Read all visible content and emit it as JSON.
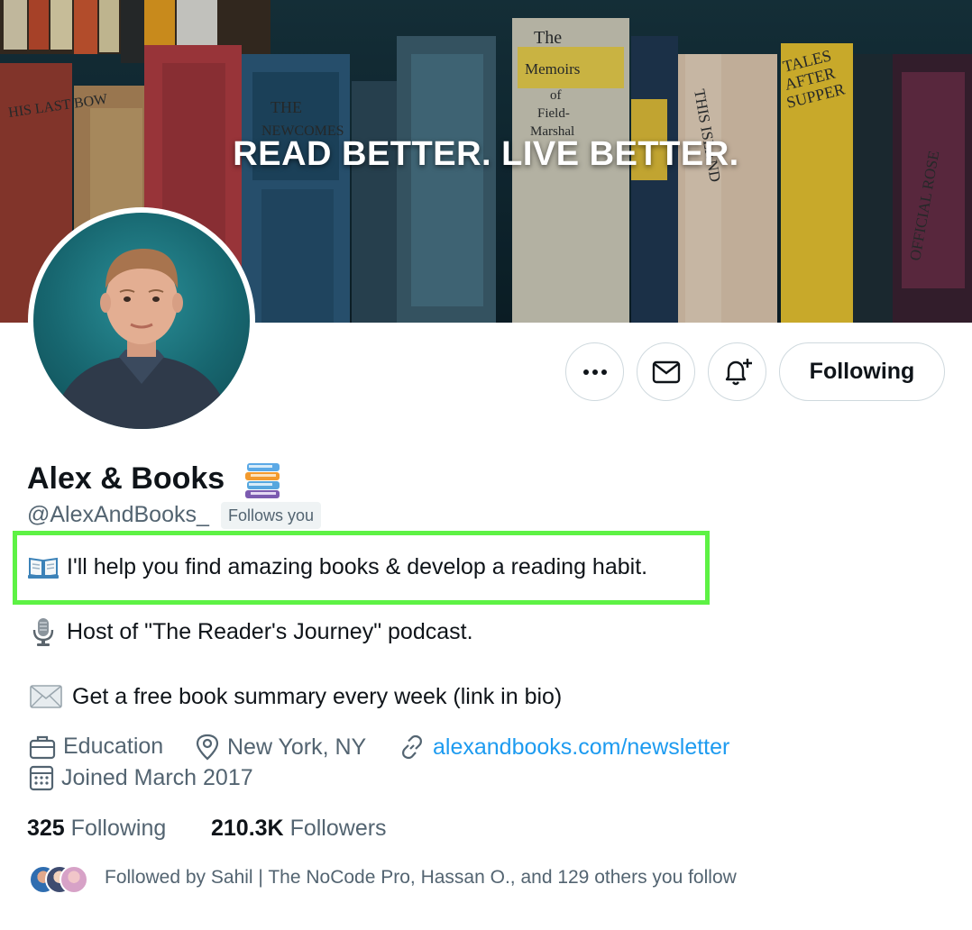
{
  "banner": {
    "tagline": "READ BETTER. LIVE BETTER."
  },
  "actions": {
    "following_label": "Following"
  },
  "profile": {
    "display_name": "Alex & Books",
    "handle": "@AlexAndBooks_",
    "follows_you_badge": "Follows you"
  },
  "bio": {
    "line1": "I'll help you find amazing books & develop a reading habit.",
    "line2": "Host of \"The Reader's Journey\" podcast.",
    "line3": "Get a free book summary every week (link in bio)"
  },
  "meta": {
    "category": "Education",
    "location": "New York, NY",
    "website": "alexandbooks.com/newsletter",
    "joined": "Joined March 2017"
  },
  "stats": {
    "following_count": "325",
    "following_label": "Following",
    "followers_count": "210.3K",
    "followers_label": "Followers"
  },
  "followed_by": "Followed by Sahil | The NoCode Pro, Hassan O., and 129 others you follow",
  "colors": {
    "accent": "#1d9bf0",
    "highlight": "#5df244",
    "muted": "#536471",
    "text": "#0f1419"
  },
  "icons": [
    "more-icon",
    "mail-icon",
    "bell-plus-icon",
    "book-icon",
    "microphone-icon",
    "envelope-emoji-icon",
    "briefcase-icon",
    "location-pin-icon",
    "link-icon",
    "calendar-icon",
    "books-stack-emoji"
  ]
}
